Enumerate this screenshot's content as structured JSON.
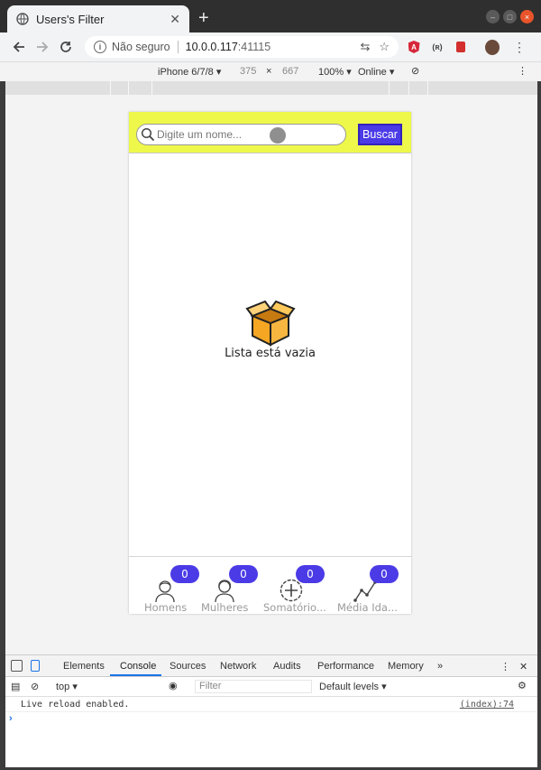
{
  "browser": {
    "tab_title": "Users's Filter",
    "tab_close": "✕",
    "new_tab": "+",
    "omnibox": {
      "security_label": "Não seguro",
      "host": "10.0.0.117",
      "port": ":41115"
    }
  },
  "device_toolbar": {
    "device": "iPhone 6/7/8 ▾",
    "width": "375",
    "times": "×",
    "height": "667",
    "zoom": "100% ▾",
    "network": "Online ▾"
  },
  "app": {
    "search": {
      "placeholder": "Digite um nome...",
      "value": ""
    },
    "search_button": "Buscar",
    "empty_message": "Lista está vazia",
    "nav": [
      {
        "label": "Homens",
        "count": "0"
      },
      {
        "label": "Mulheres",
        "count": "0"
      },
      {
        "label": "Somatório...",
        "count": "0"
      },
      {
        "label": "Média Ida...",
        "count": "0"
      }
    ],
    "colors": {
      "header": "#eef84a",
      "accent": "#4b3be6"
    }
  },
  "devtools": {
    "tabs": [
      "Elements",
      "Console",
      "Sources",
      "Network",
      "Audits",
      "Performance",
      "Memory",
      "»"
    ],
    "context": "top ▾",
    "filter_placeholder": "Filter",
    "levels": "Default levels ▾",
    "log": {
      "message": "Live reload enabled.",
      "source": "(index):74"
    },
    "prompt": "›"
  }
}
